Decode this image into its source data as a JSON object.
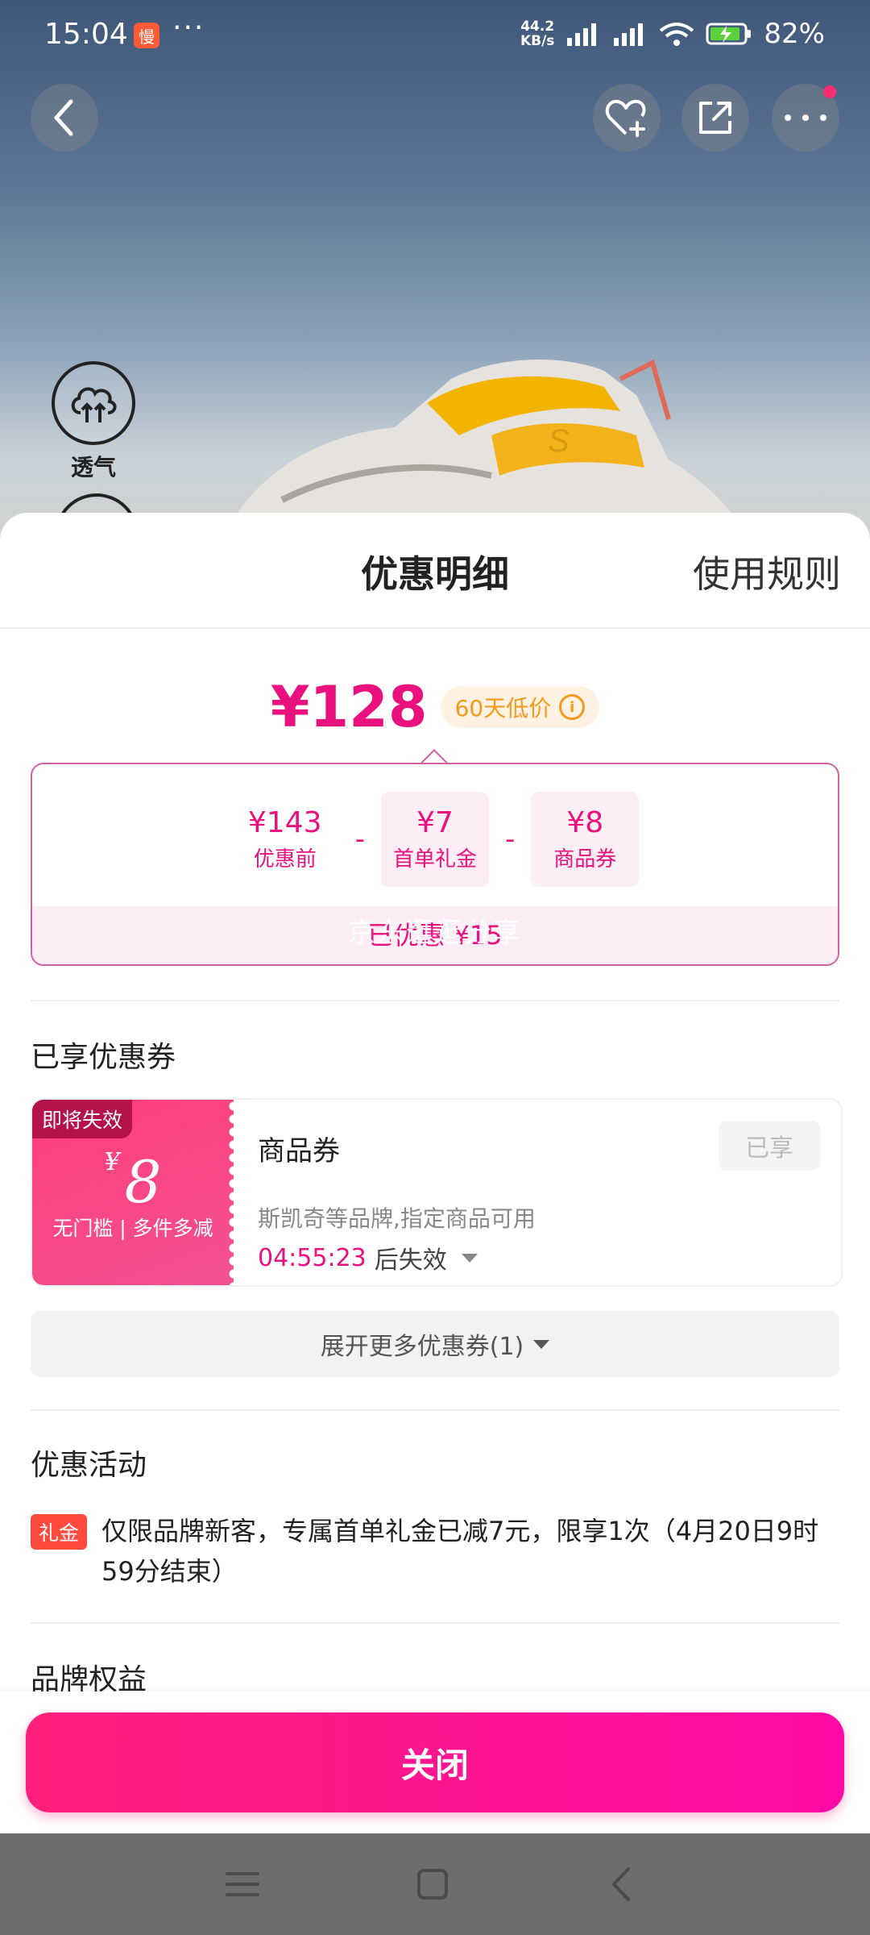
{
  "status_bar": {
    "time": "15:04",
    "app_badge": "慢",
    "dots": "···",
    "net_speed_value": "44.2",
    "net_speed_unit": "KB/s",
    "battery": "82%"
  },
  "product": {
    "feature_label": "透气"
  },
  "sheet": {
    "title": "优惠明细",
    "rules_label": "使用规则",
    "final_price": "¥128",
    "low_price_badge": "60天低价",
    "breakdown": {
      "items": [
        {
          "value": "¥143",
          "label": "优惠前"
        },
        {
          "value": "¥7",
          "label": "首单礼金"
        },
        {
          "value": "¥8",
          "label": "商品券"
        }
      ],
      "operator": "-",
      "total": "已优惠 ¥15",
      "watermark": "京东逛逛分享"
    },
    "coupons_section_title": "已享优惠券",
    "coupon": {
      "expire_tag": "即将失效",
      "currency": "¥",
      "amount": "8",
      "condition": "无门槛 | 多件多减",
      "name": "商品券",
      "status": "已享",
      "description": "斯凯奇等品牌,指定商品可用",
      "countdown": "04:55:23",
      "countdown_suffix": "后失效"
    },
    "expand_label": "展开更多优惠券(1)",
    "activities_section_title": "优惠活动",
    "activity": {
      "tag": "礼金",
      "text": "仅限品牌新客，专属首单礼金已减7元，限享1次（4月20日9时59分结束）"
    },
    "brand_section_title": "品牌权益",
    "close_label": "关闭"
  },
  "colors": {
    "accent": "#e8117d",
    "close_gradient_start": "#ff1f7b",
    "close_gradient_end": "#ff0aa5",
    "low_price": "#f29a1c",
    "gift_tag": "#ff4a3e"
  },
  "icons": [
    "back-icon",
    "favorite-add-icon",
    "share-icon",
    "more-icon",
    "breathable-icon",
    "info-icon",
    "chevron-down-icon",
    "menu-nav-icon",
    "home-nav-icon",
    "back-nav-icon",
    "wifi-icon",
    "signal-icon",
    "battery-icon"
  ]
}
